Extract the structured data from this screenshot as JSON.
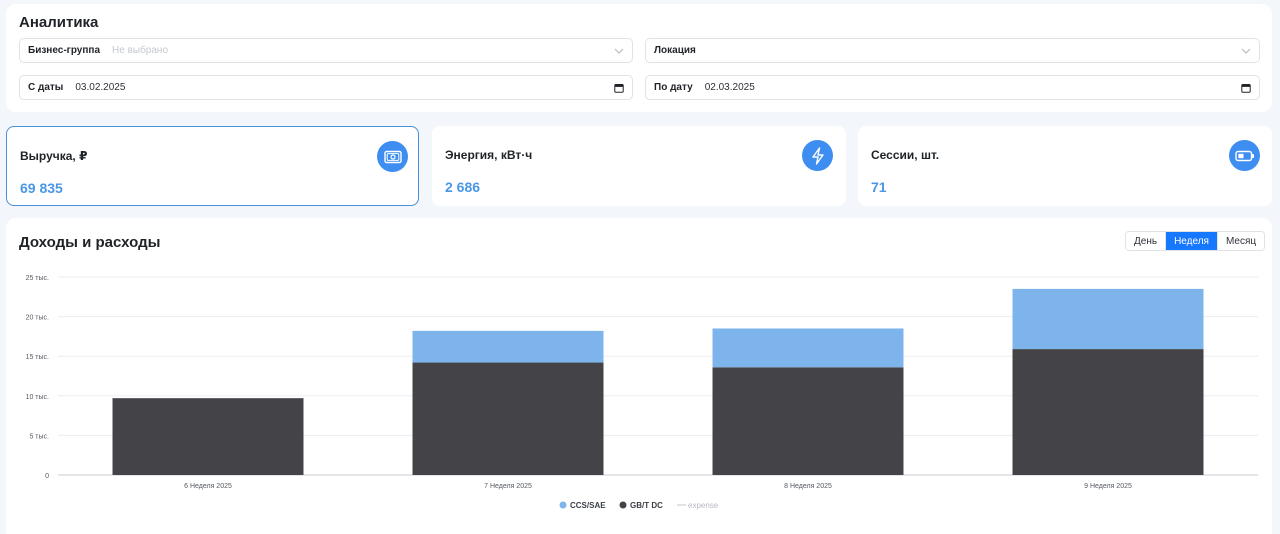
{
  "filters": {
    "title": "Аналитика",
    "business_group": {
      "label": "Бизнес-группа",
      "placeholder": "Не выбрано"
    },
    "location": {
      "label": "Локация"
    },
    "date_from": {
      "label": "С даты",
      "value": "03.02.2025"
    },
    "date_to": {
      "label": "По дату",
      "value": "02.03.2025"
    }
  },
  "cards": [
    {
      "title": "Выручка, ₽",
      "value": "69 835",
      "icon": "money-icon",
      "active": true
    },
    {
      "title": "Энергия, кВт·ч",
      "value": "2 686",
      "icon": "lightning-icon",
      "active": false
    },
    {
      "title": "Сессии, шт.",
      "value": "71",
      "icon": "battery-icon",
      "active": false
    }
  ],
  "chart_panel": {
    "title": "Доходы и расходы",
    "period_tabs": [
      {
        "label": "День",
        "selected": false
      },
      {
        "label": "Неделя",
        "selected": true
      },
      {
        "label": "Месяц",
        "selected": false
      }
    ]
  },
  "colors": {
    "accent": "#1677ff",
    "ccs": "#7db4ec",
    "gbt": "#444448",
    "icon_bg": "#3d8ef0",
    "value": "#4a97e4"
  },
  "chart_data": {
    "type": "bar",
    "stacked": true,
    "categories": [
      "6 Неделя 2025",
      "7 Неделя 2025",
      "8 Неделя 2025",
      "9 Неделя 2025"
    ],
    "series": [
      {
        "name": "GB/T DC",
        "values": [
          9700,
          14200,
          13600,
          15900
        ]
      },
      {
        "name": "CCS/SAE",
        "values": [
          0,
          4000,
          4900,
          7600
        ]
      },
      {
        "name": "expense",
        "values": [
          0,
          0,
          0,
          0
        ]
      }
    ],
    "yticks": [
      {
        "value": 0,
        "label": "0"
      },
      {
        "value": 5000,
        "label": "5 тыс."
      },
      {
        "value": 10000,
        "label": "10 тыс."
      },
      {
        "value": 15000,
        "label": "15 тыс."
      },
      {
        "value": 20000,
        "label": "20 тыс."
      },
      {
        "value": 25000,
        "label": "25 тыс."
      }
    ],
    "ylim": [
      0,
      25000
    ],
    "grid": true,
    "legend_placement": "bottom-center",
    "legend": [
      {
        "name": "CCS/SAE",
        "marker": "dot"
      },
      {
        "name": "GB/T DC",
        "marker": "dot"
      },
      {
        "name": "expense",
        "marker": "line"
      }
    ]
  }
}
